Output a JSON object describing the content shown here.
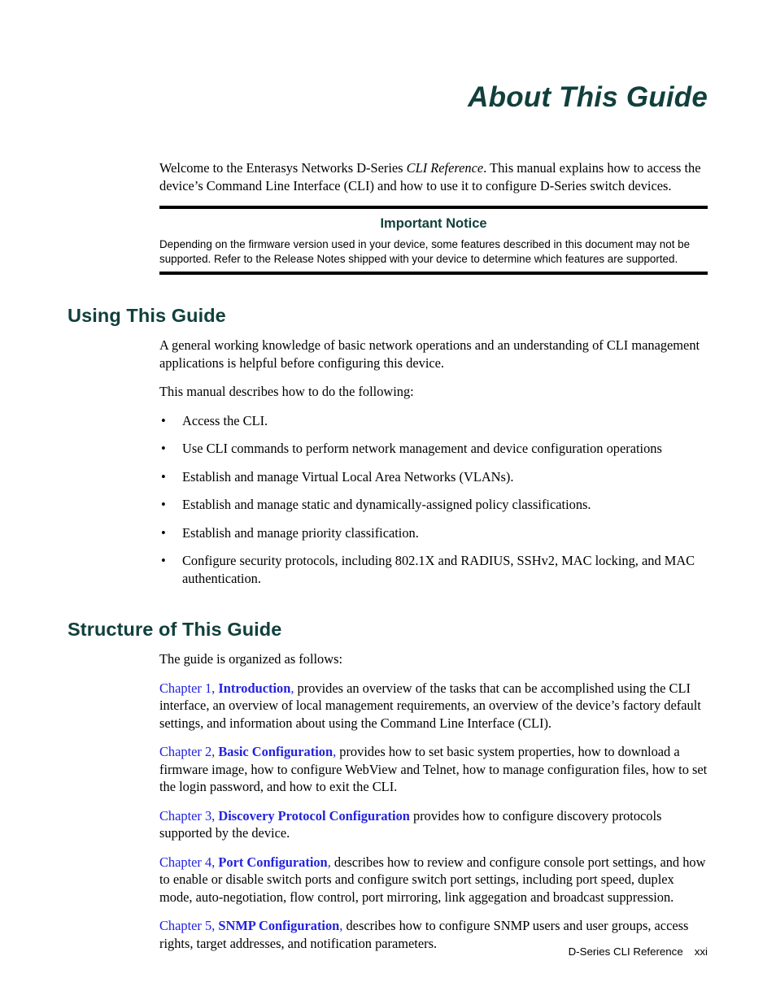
{
  "document": {
    "page_title": "About This Guide",
    "footer": {
      "manual_name": "D-Series CLI Reference",
      "page_number": "xxi"
    },
    "colors": {
      "heading_teal": "#11403C",
      "cross_reference_blue": "#2222DD",
      "body_black": "#000000",
      "page_background": "#FFFFFF"
    }
  },
  "intro": {
    "welcome_part1": "Welcome to the Enterasys Networks D-Series ",
    "welcome_italic": "CLI Reference",
    "welcome_part2": ". This manual explains how to access the device’s Command Line Interface (CLI) and how to use it to configure D-Series switch devices."
  },
  "notice": {
    "title": "Important Notice",
    "body": "Depending on the firmware version used in your device, some features described in this document may not be supported. Refer to the Release Notes shipped with your device to determine which features are supported."
  },
  "using_this_guide": {
    "heading": "Using This Guide",
    "paragraph1": "A general working knowledge of basic network operations and an understanding of CLI management applications is helpful before configuring this device.",
    "paragraph2": "This manual describes how to do the following:",
    "bullet_marker": "•",
    "bullets": [
      "Access the CLI.",
      "Use CLI commands to perform network management and device configuration operations",
      "Establish and manage Virtual Local Area Networks (VLANs).",
      "Establish and manage static and dynamically-assigned policy classifications.",
      "Establish and manage priority classification.",
      "Configure security protocols, including 802.1X and RADIUS, SSHv2, MAC locking, and MAC authentication."
    ]
  },
  "structure_of_this_guide": {
    "heading": "Structure of This Guide",
    "intro": "The guide is organized as follows:",
    "chapters": [
      {
        "ref": "Chapter 1, ",
        "title": "Introduction",
        "separator": ", ",
        "description": "provides an overview of the tasks that can be accomplished using the CLI interface, an overview of local management requirements, an overview of the device’s factory default settings, and information about using the Command Line Interface (CLI)."
      },
      {
        "ref": "Chapter 2, ",
        "title": "Basic Configuration",
        "separator": ", ",
        "description": "provides how to set basic system properties, how to download a firmware image, how to configure WebView and Telnet, how to manage configuration files, how to set the login password, and how to exit the CLI."
      },
      {
        "ref": "Chapter 3, ",
        "title": "Discovery Protocol Configuration",
        "separator": " ",
        "description": "provides how to configure discovery protocols supported by the device."
      },
      {
        "ref": "Chapter 4, ",
        "title": "Port Configuration",
        "separator": ", ",
        "description": "describes how to review and configure console port settings, and how to enable or disable switch ports and configure switch port settings, including port speed, duplex mode, auto-negotiation, flow control, port mirroring, link aggegation and broadcast suppression."
      },
      {
        "ref": "Chapter 5, ",
        "title": "SNMP Configuration",
        "separator": ", ",
        "description": "describes how to configure SNMP users and user groups, access rights, target addresses, and notification parameters."
      }
    ]
  }
}
